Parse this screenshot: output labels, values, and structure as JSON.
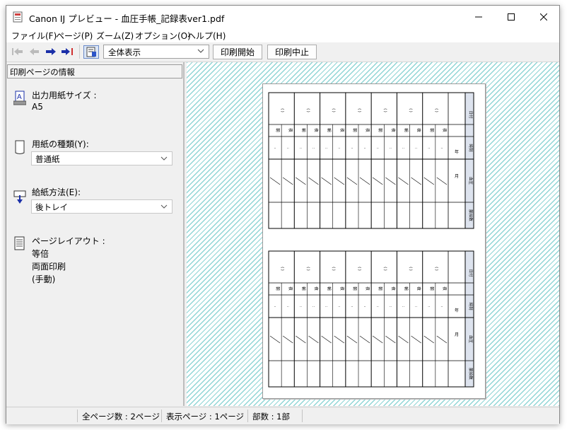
{
  "window": {
    "title": "Canon IJ プレビュー - 血圧手帳_記録表ver1.pdf",
    "controls": {
      "minimize": "minimize",
      "maximize": "maximize",
      "close": "close"
    }
  },
  "menu": [
    "ファイル(F)",
    "ページ(P)",
    "ズーム(Z)",
    "オプション(O)",
    "ヘルプ(H)"
  ],
  "toolbar": {
    "zoom_value": "全体表示",
    "print_start": "印刷開始",
    "print_cancel": "印刷中止"
  },
  "info_panel": {
    "header": "印刷ページの情報",
    "paper_size_label": "出力用紙サイズ :",
    "paper_size_value": "A5",
    "media_type_label": "用紙の種類(Y):",
    "media_type_value": "普通紙",
    "paper_source_label": "給紙方法(E):",
    "paper_source_value": "後トレイ",
    "layout_label": "ページレイアウト :",
    "layout_value_1": "等倍",
    "layout_value_2": "両面印刷",
    "layout_value_3": "(手動)"
  },
  "status": {
    "total_pages": "全ページ数 : 2ページ",
    "current_page": "表示ページ : 1ページ",
    "copies": "部数 : 1部"
  },
  "form": {
    "headers": [
      "日付",
      "時刻",
      "血圧",
      "脈拍数"
    ],
    "date_marks": [
      "年",
      "月"
    ],
    "row_labels": [
      "朝",
      "夜",
      "朝",
      "夜",
      "朝",
      "夜",
      "朝",
      "夜",
      "朝",
      "夜",
      "朝",
      "夜",
      "朝",
      "夜"
    ],
    "day_cols": 7
  }
}
